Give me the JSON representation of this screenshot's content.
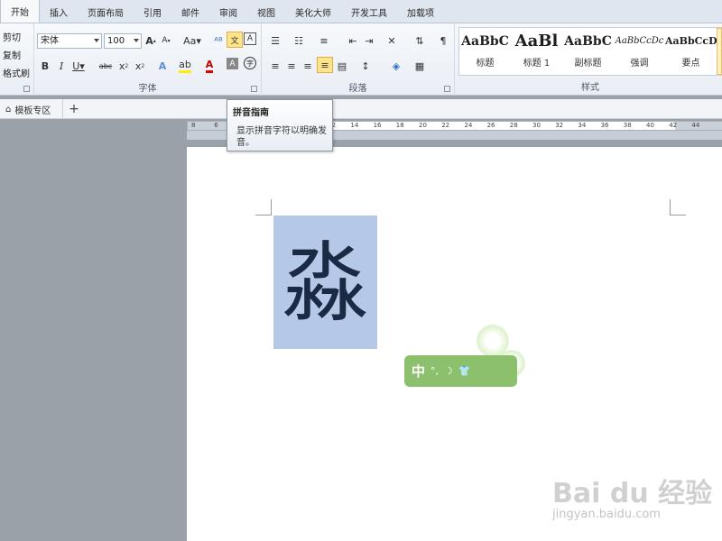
{
  "tabs": [
    "开始",
    "插入",
    "页面布局",
    "引用",
    "邮件",
    "审阅",
    "视图",
    "美化大师",
    "开发工具",
    "加载项"
  ],
  "active_tab": "开始",
  "clipboard": {
    "cut": "剪切",
    "copy": "复制",
    "format_painter": "格式刷"
  },
  "font": {
    "name": "宋体",
    "size": "100",
    "group_label": "字体"
  },
  "paragraph": {
    "group_label": "段落"
  },
  "styles": {
    "group_label": "样式",
    "items": [
      {
        "sample": "AaBbC",
        "name": "标题"
      },
      {
        "sample": "AaBl",
        "name": "标题 1"
      },
      {
        "sample": "AaBbC",
        "name": "副标题"
      },
      {
        "sample": "AaBbCcDc",
        "name": "强调"
      },
      {
        "sample": "AaBbCcD",
        "name": "要点"
      }
    ]
  },
  "doc_tab": {
    "label": "模板专区",
    "new_tab": "+"
  },
  "ruler_ticks": [
    "8",
    "6",
    "2",
    "6",
    "8",
    "10",
    "12",
    "14",
    "16",
    "18",
    "20",
    "22",
    "24",
    "26",
    "28",
    "30",
    "32",
    "34",
    "36",
    "38",
    "40",
    "42",
    "44"
  ],
  "tooltip": {
    "title": "拼音指南",
    "body": "显示拼音字符以明确发音。"
  },
  "document": {
    "text": "淼"
  },
  "ime": {
    "mode": "中"
  },
  "watermark": {
    "brand": "Bai du 经验",
    "url": "jingyan.baidu.com"
  },
  "colors": {
    "accent": "#ffe38a",
    "selection": "#b5c8e8",
    "ime": "#8cc06c"
  }
}
